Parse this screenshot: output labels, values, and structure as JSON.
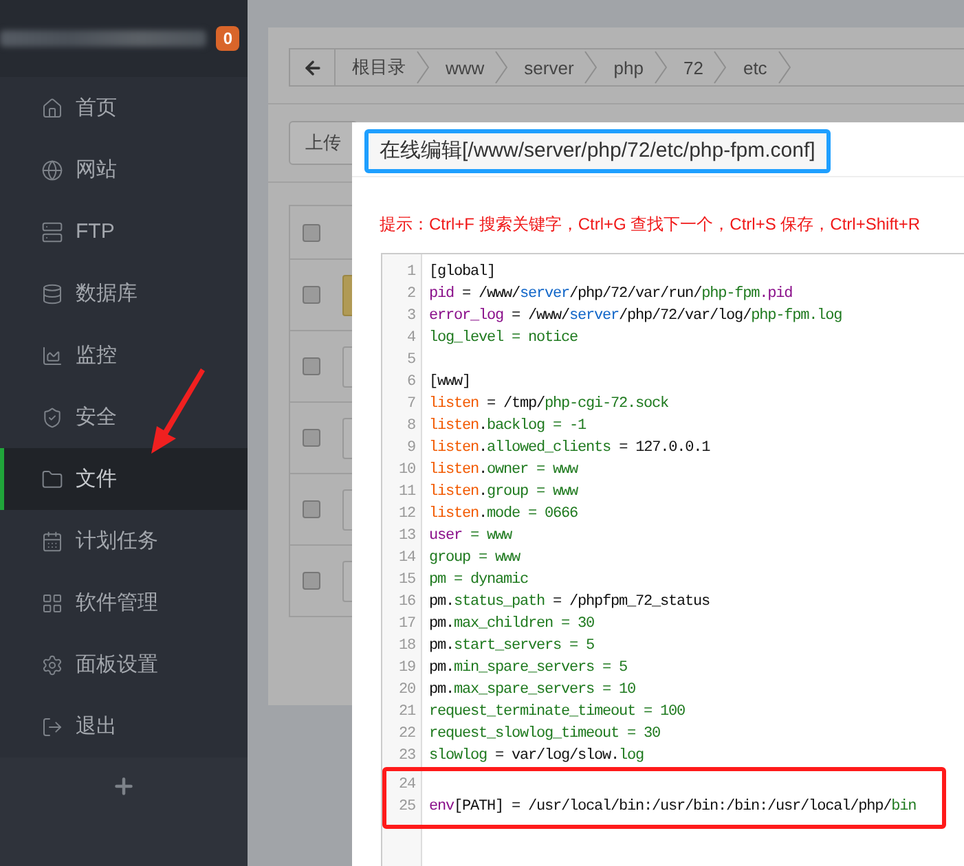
{
  "sidebar": {
    "badge": "0",
    "items": [
      {
        "label": "首页",
        "selected": false
      },
      {
        "label": "网站",
        "selected": false
      },
      {
        "label": "FTP",
        "selected": false
      },
      {
        "label": "数据库",
        "selected": false
      },
      {
        "label": "监控",
        "selected": false
      },
      {
        "label": "安全",
        "selected": false
      },
      {
        "label": "文件",
        "selected": true
      },
      {
        "label": "计划任务",
        "selected": false
      },
      {
        "label": "软件管理",
        "selected": false
      },
      {
        "label": "面板设置",
        "selected": false
      },
      {
        "label": "退出",
        "selected": false
      }
    ]
  },
  "breadcrumb": {
    "segments": [
      "根目录",
      "www",
      "server",
      "php",
      "72",
      "etc"
    ]
  },
  "toolbar": {
    "buttons": [
      "上传"
    ]
  },
  "table": {
    "header": {
      "checked": false
    },
    "rows": [
      {
        "kind": "folder",
        "checked": false
      },
      {
        "kind": "file",
        "checked": false
      },
      {
        "kind": "file",
        "checked": false
      },
      {
        "kind": "file",
        "checked": false
      },
      {
        "kind": "file",
        "checked": false
      }
    ]
  },
  "editor": {
    "title": "在线编辑[/www/server/php/72/etc/php-fpm.conf]",
    "hint": "提示：Ctrl+F 搜索关键字，Ctrl+G 查找下一个，Ctrl+S 保存，Ctrl+Shift+R",
    "lines": [
      {
        "number": "1",
        "highlighted": false,
        "tokens": [
          {
            "text": "[global]",
            "kind": "plain"
          }
        ]
      },
      {
        "number": "2",
        "highlighted": false,
        "tokens": [
          {
            "text": "pid",
            "kind": "variable"
          },
          {
            "text": " = /www/",
            "kind": "plain"
          },
          {
            "text": "server",
            "kind": "keyword"
          },
          {
            "text": "/php/72/var/run/",
            "kind": "plain"
          },
          {
            "text": "php-fpm",
            "kind": "string"
          },
          {
            "text": ".pid",
            "kind": "variable"
          }
        ]
      },
      {
        "number": "3",
        "highlighted": false,
        "tokens": [
          {
            "text": "error_log",
            "kind": "variable"
          },
          {
            "text": " = /www/",
            "kind": "plain"
          },
          {
            "text": "server",
            "kind": "keyword"
          },
          {
            "text": "/php/72/var/log/",
            "kind": "plain"
          },
          {
            "text": "php-fpm.log",
            "kind": "string"
          }
        ]
      },
      {
        "number": "4",
        "highlighted": false,
        "tokens": [
          {
            "text": "log_level = notice",
            "kind": "string"
          }
        ]
      },
      {
        "number": "5",
        "highlighted": false
      },
      {
        "number": "6",
        "highlighted": false,
        "tokens": [
          {
            "text": "[www]",
            "kind": "plain"
          }
        ]
      },
      {
        "number": "7",
        "highlighted": false,
        "tokens": [
          {
            "text": "listen",
            "kind": "property"
          },
          {
            "text": " = /tmp/",
            "kind": "plain"
          },
          {
            "text": "php-cgi-72.sock",
            "kind": "string"
          }
        ]
      },
      {
        "number": "8",
        "highlighted": false,
        "tokens": [
          {
            "text": "listen",
            "kind": "property"
          },
          {
            "text": ".",
            "kind": "plain"
          },
          {
            "text": "backlog = -1",
            "kind": "string"
          }
        ]
      },
      {
        "number": "9",
        "highlighted": false,
        "tokens": [
          {
            "text": "listen",
            "kind": "property"
          },
          {
            "text": ".",
            "kind": "plain"
          },
          {
            "text": "allowed_clients",
            "kind": "string"
          },
          {
            "text": " = 127.0.0.1",
            "kind": "plain"
          }
        ]
      },
      {
        "number": "10",
        "highlighted": false,
        "tokens": [
          {
            "text": "listen",
            "kind": "property"
          },
          {
            "text": ".",
            "kind": "plain"
          },
          {
            "text": "owner = www",
            "kind": "string"
          }
        ]
      },
      {
        "number": "11",
        "highlighted": false,
        "tokens": [
          {
            "text": "listen",
            "kind": "property"
          },
          {
            "text": ".",
            "kind": "plain"
          },
          {
            "text": "group = www",
            "kind": "string"
          }
        ]
      },
      {
        "number": "12",
        "highlighted": false,
        "tokens": [
          {
            "text": "listen",
            "kind": "property"
          },
          {
            "text": ".",
            "kind": "plain"
          },
          {
            "text": "mode = 0666",
            "kind": "string"
          }
        ]
      },
      {
        "number": "13",
        "highlighted": false,
        "tokens": [
          {
            "text": "user",
            "kind": "variable"
          },
          {
            "text": " = www",
            "kind": "string"
          }
        ]
      },
      {
        "number": "14",
        "highlighted": false,
        "tokens": [
          {
            "text": "group = www",
            "kind": "string"
          }
        ]
      },
      {
        "number": "15",
        "highlighted": false,
        "tokens": [
          {
            "text": "pm = dynamic",
            "kind": "string"
          }
        ]
      },
      {
        "number": "16",
        "highlighted": false,
        "tokens": [
          {
            "text": "pm.",
            "kind": "plain"
          },
          {
            "text": "status_path",
            "kind": "string"
          },
          {
            "text": " = /phpfpm_72_status",
            "kind": "plain"
          }
        ]
      },
      {
        "number": "17",
        "highlighted": false,
        "tokens": [
          {
            "text": "pm.",
            "kind": "plain"
          },
          {
            "text": "max_children = 30",
            "kind": "string"
          }
        ]
      },
      {
        "number": "18",
        "highlighted": false,
        "tokens": [
          {
            "text": "pm.",
            "kind": "plain"
          },
          {
            "text": "start_servers = 5",
            "kind": "string"
          }
        ]
      },
      {
        "number": "19",
        "highlighted": false,
        "tokens": [
          {
            "text": "pm.",
            "kind": "plain"
          },
          {
            "text": "min_spare_servers = 5",
            "kind": "string"
          }
        ]
      },
      {
        "number": "20",
        "highlighted": false,
        "tokens": [
          {
            "text": "pm.",
            "kind": "plain"
          },
          {
            "text": "max_spare_servers = 10",
            "kind": "string"
          }
        ]
      },
      {
        "number": "21",
        "highlighted": false,
        "tokens": [
          {
            "text": "request_terminate_timeout = 100",
            "kind": "string"
          }
        ]
      },
      {
        "number": "22",
        "highlighted": false,
        "tokens": [
          {
            "text": "request_slowlog_timeout = 30",
            "kind": "string"
          }
        ]
      },
      {
        "number": "23",
        "highlighted": false,
        "tokens": [
          {
            "text": "slowlog",
            "kind": "string"
          },
          {
            "text": " = var/log/slow.",
            "kind": "plain"
          },
          {
            "text": "log",
            "kind": "string"
          }
        ]
      },
      {
        "number": "24",
        "highlighted": true
      },
      {
        "number": "25",
        "highlighted": true,
        "tokens": [
          {
            "text": "env",
            "kind": "variable"
          },
          {
            "text": "[PATH] = /usr/local/bin:/usr/bin:/bin:/usr/local/php/",
            "kind": "plain"
          },
          {
            "text": "bin",
            "kind": "string"
          }
        ]
      }
    ]
  }
}
